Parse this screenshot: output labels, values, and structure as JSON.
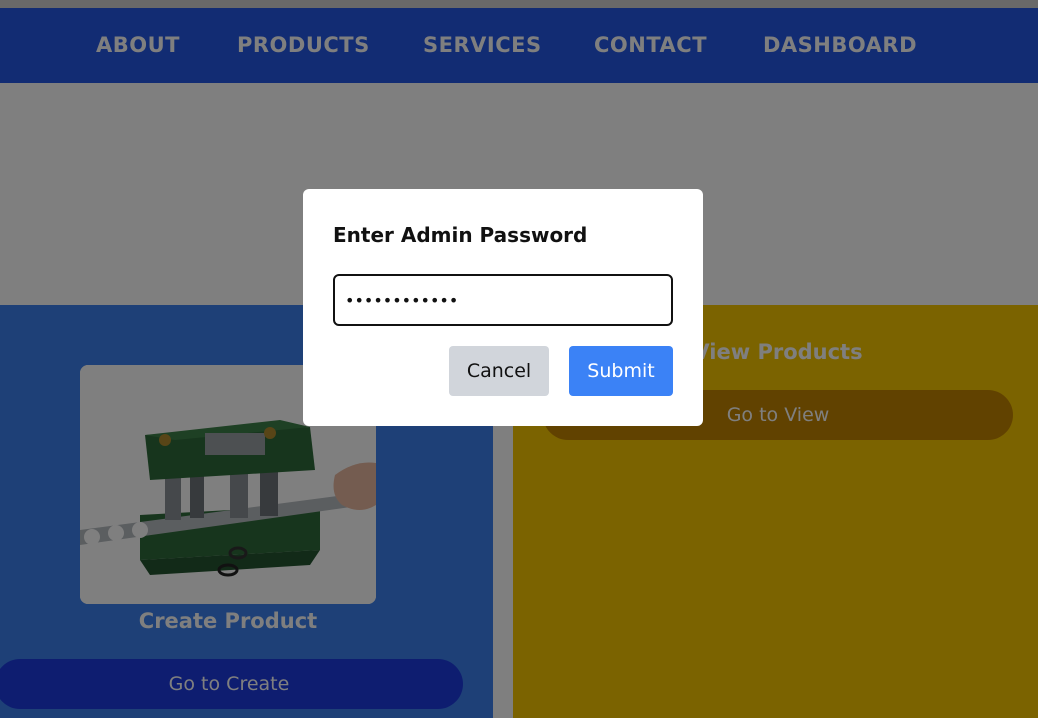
{
  "nav": {
    "items": [
      {
        "label": "ABOUT"
      },
      {
        "label": "PRODUCTS"
      },
      {
        "label": "SERVICES"
      },
      {
        "label": "CONTACT"
      },
      {
        "label": "DASHBOARD"
      }
    ]
  },
  "cards": {
    "create": {
      "title": "Create Product",
      "button": "Go to Create",
      "image_icon": "press-die-tool-image"
    },
    "view": {
      "title": "View Products",
      "button": "Go to View"
    }
  },
  "modal": {
    "title": "Enter Admin Password",
    "password_value": "••••••••••••",
    "cancel_label": "Cancel",
    "submit_label": "Submit"
  },
  "colors": {
    "nav_bg": "#2458e6",
    "create_card_bg": "#3c80ee",
    "view_card_bg": "#f7c600",
    "submit_bg": "#3b82f6",
    "cancel_bg": "#d1d5db"
  }
}
